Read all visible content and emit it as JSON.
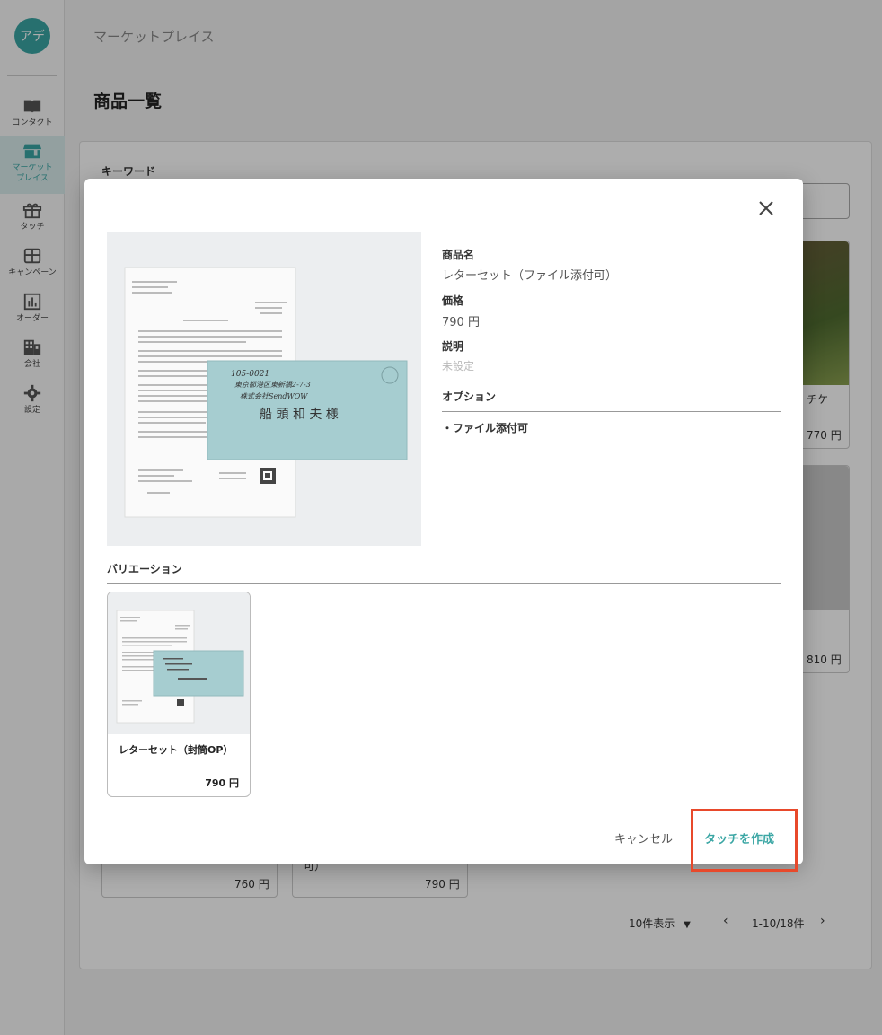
{
  "sidebar": {
    "avatar_text": "アデ",
    "items": [
      {
        "label": "コンタクト",
        "icon": "book-icon"
      },
      {
        "label": "マーケット\nプレイス",
        "icon": "store-icon"
      },
      {
        "label": "タッチ",
        "icon": "gift-icon"
      },
      {
        "label": "キャンペーン",
        "icon": "campaign-icon"
      },
      {
        "label": "オーダー",
        "icon": "chart-icon"
      },
      {
        "label": "会社",
        "icon": "building-icon"
      },
      {
        "label": "設定",
        "icon": "gear-icon"
      }
    ],
    "active_index": 1
  },
  "page": {
    "breadcrumb": "マーケットプレイス",
    "title": "商品一覧",
    "keyword_label": "キーワード"
  },
  "background_cards": {
    "card1_text": "チケ",
    "card1_price": "770 円",
    "card2_price": "810 円",
    "card3_price": "760 円",
    "card4_text": "可）",
    "card4_price": "790 円"
  },
  "pager": {
    "per_page": "10件表示",
    "range": "1-10/18件"
  },
  "modal": {
    "name_label": "商品名",
    "name_value": "レターセット（ファイル添付可）",
    "price_label": "価格",
    "price_value": "790 円",
    "desc_label": "説明",
    "desc_value": "未設定",
    "options_label": "オプション",
    "option_item": "・ファイル添付可",
    "variation_label": "バリエーション",
    "variation": {
      "name": "レターセット（封筒OP）",
      "price": "790 円"
    },
    "cancel_label": "キャンセル",
    "create_label": "タッチを作成",
    "envelope_text": {
      "postal": "105-0021",
      "address": "東京都港区東新橋2-7-3",
      "company": "株式会社SendWOW",
      "recipient": "船 頭 和 夫 様"
    }
  },
  "colors": {
    "accent": "#3aa6a4",
    "highlight": "#e8492b",
    "envelope": "#a6cdd0"
  }
}
